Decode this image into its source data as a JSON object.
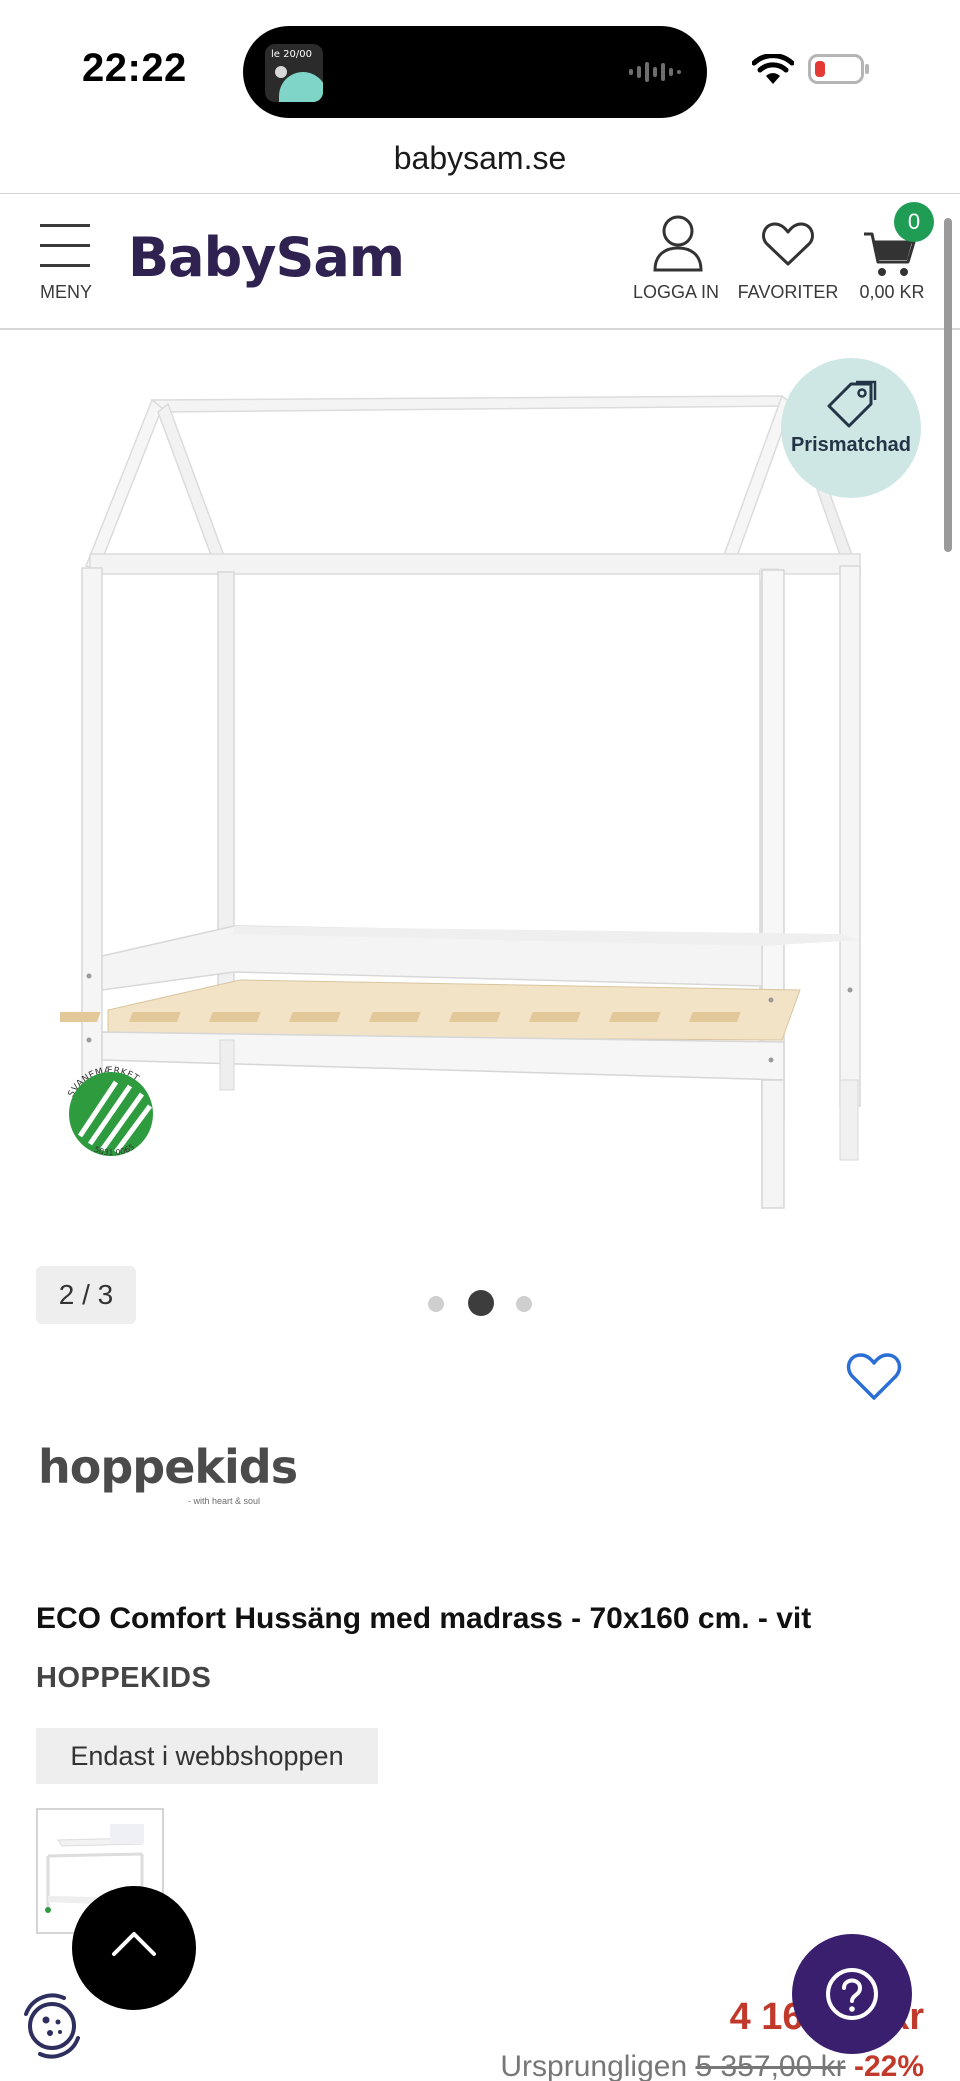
{
  "status_bar": {
    "time": "22:22",
    "now_playing_thumb_text": "le 20/00"
  },
  "browser": {
    "url": "babysam.se"
  },
  "header": {
    "menu_label": "MENY",
    "logo_text": "BabySam",
    "login_label": "LOGGA IN",
    "favorites_label": "FAVORITER",
    "cart_total": "0,00 KR",
    "cart_count": "0"
  },
  "gallery": {
    "badge_text": "Prismatchad",
    "eco_label_text": "SVANEMÆRKET",
    "eco_label_number": "5031 0065",
    "counter": "2 / 3",
    "current_index": 2,
    "total": 3
  },
  "brand": {
    "logo_text": "hoppekids",
    "logo_tagline": "- with heart & soul"
  },
  "product": {
    "title": "ECO Comfort Hussäng med madrass - 70x160 cm. - vit",
    "brand": "HOPPEKIDS",
    "availability_badge": "Endast i webbshoppen",
    "price": "4 167,00 kr",
    "original_prefix": "Ursprungligen",
    "original_price": "5 357,00 kr",
    "discount": "-22%"
  },
  "colors": {
    "brand_purple": "#2f2150",
    "cart_badge_green": "#1f9d55",
    "price_red": "#c0392b",
    "prisma_badge_bg": "#cfe7e4",
    "heart_blue": "#2b6fd6"
  }
}
